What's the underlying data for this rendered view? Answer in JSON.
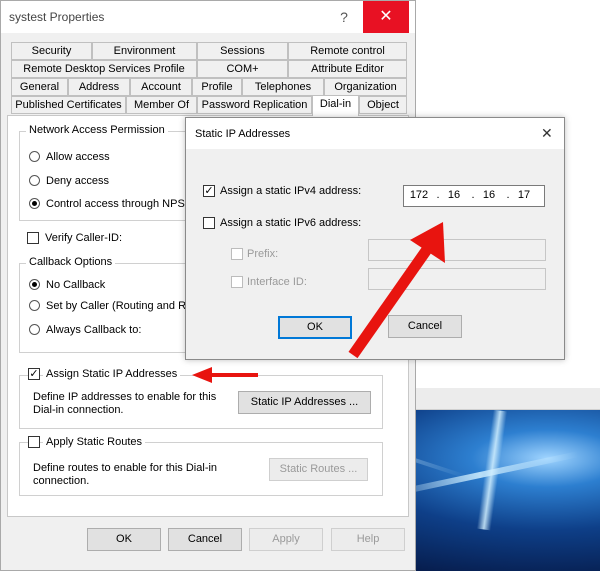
{
  "props": {
    "title": "systest Properties",
    "help_glyph": "?",
    "close_glyph": "✕",
    "tabs_row1": [
      "Security",
      "Environment",
      "Sessions",
      "Remote control"
    ],
    "tabs_row2": [
      "Remote Desktop Services Profile",
      "COM+",
      "Attribute Editor"
    ],
    "tabs_row3": [
      "General",
      "Address",
      "Account",
      "Profile",
      "Telephones",
      "Organization"
    ],
    "tabs_row4": [
      "Published Certificates",
      "Member Of",
      "Password Replication",
      "Dial-in",
      "Object"
    ],
    "active_tab": "Dial-in",
    "network_access": {
      "legend": "Network Access Permission",
      "options": [
        "Allow access",
        "Deny access",
        "Control access through NPS N"
      ],
      "selected": 2
    },
    "verify_caller_id": {
      "label": "Verify Caller-ID:",
      "checked": false
    },
    "callback": {
      "legend": "Callback Options",
      "options": [
        "No Callback",
        "Set by Caller (Routing and Re",
        "Always Callback to:"
      ],
      "selected": 0
    },
    "static_ip": {
      "label": "Assign Static IP Addresses",
      "checked": true,
      "check_glyph": "✓",
      "description": [
        "Define IP addresses to enable for this",
        "Dial-in connection."
      ],
      "button": "Static IP Addresses ..."
    },
    "static_routes": {
      "label": "Apply Static Routes",
      "checked": false,
      "description": [
        "Define routes to enable for this Dial-in",
        "connection."
      ],
      "button": "Static Routes ..."
    },
    "buttons": {
      "ok": "OK",
      "cancel": "Cancel",
      "apply": "Apply",
      "help": "Help"
    }
  },
  "dialog": {
    "title": "Static IP Addresses",
    "close_glyph": "✕",
    "ipv4": {
      "label": "Assign a static IPv4 address:",
      "checked": true,
      "check_glyph": "✓",
      "octets": [
        "172",
        "16",
        "16",
        "17"
      ],
      "dot": "."
    },
    "ipv6": {
      "label": "Assign a static IPv6 address:",
      "checked": false
    },
    "prefix": {
      "label": "Prefix:",
      "value": ""
    },
    "interface_id": {
      "label": "Interface ID:",
      "value": ""
    },
    "ok": "OK",
    "cancel": "Cancel"
  },
  "annotations": {
    "arrow_color": "#e8140f"
  },
  "colors": {
    "close_red": "#e81123",
    "accent": "#0078d7"
  }
}
